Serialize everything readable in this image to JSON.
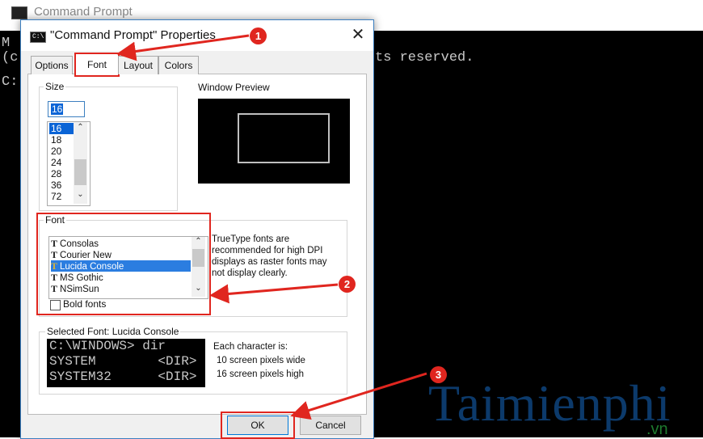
{
  "console": {
    "title": "Command Prompt",
    "line_1": "M",
    "line_2": "(c",
    "line_2_tail": "ts reserved.",
    "line_3": "C:"
  },
  "watermark": {
    "text": "Taimienphi",
    "sub": ".vn"
  },
  "dialog": {
    "title": "\"Command Prompt\" Properties",
    "close_glyph": "✕",
    "tabs": [
      {
        "label": "Options"
      },
      {
        "label": "Font"
      },
      {
        "label": "Layout"
      },
      {
        "label": "Colors"
      }
    ],
    "size": {
      "label": "Size",
      "value": "16",
      "options": [
        "16",
        "18",
        "20",
        "24",
        "28",
        "36",
        "72"
      ],
      "selected": "16"
    },
    "preview": {
      "label": "Window Preview"
    },
    "font": {
      "label": "Font",
      "items": [
        {
          "icon": "truetype-icon",
          "glyph": "T",
          "name": "Consolas"
        },
        {
          "icon": "truetype-icon",
          "glyph": "T",
          "name": "Courier New"
        },
        {
          "icon": "truetype-icon",
          "glyph": "T",
          "name": "Lucida Console"
        },
        {
          "icon": "truetype-icon",
          "glyph": "T",
          "name": "MS Gothic"
        },
        {
          "icon": "truetype-icon",
          "glyph": "T",
          "name": "NSimSun"
        }
      ],
      "selected": "Lucida Console",
      "bold_label": "Bold fonts",
      "note": "TrueType fonts are recommended for high DPI displays as raster fonts may not display clearly."
    },
    "selected_font": {
      "label": "Selected Font: Lucida Console",
      "sample_lines": [
        "C:\\WINDOWS> dir",
        "SYSTEM        <DIR>",
        "SYSTEM32      <DIR>"
      ],
      "char_info_title": "Each character is:",
      "width_info": "10 screen pixels wide",
      "height_info": "16 screen pixels high"
    },
    "buttons": {
      "ok": "OK",
      "cancel": "Cancel"
    }
  },
  "annotations": {
    "badge_1": "1",
    "badge_2": "2",
    "badge_3": "3",
    "color": "#e0261f"
  }
}
